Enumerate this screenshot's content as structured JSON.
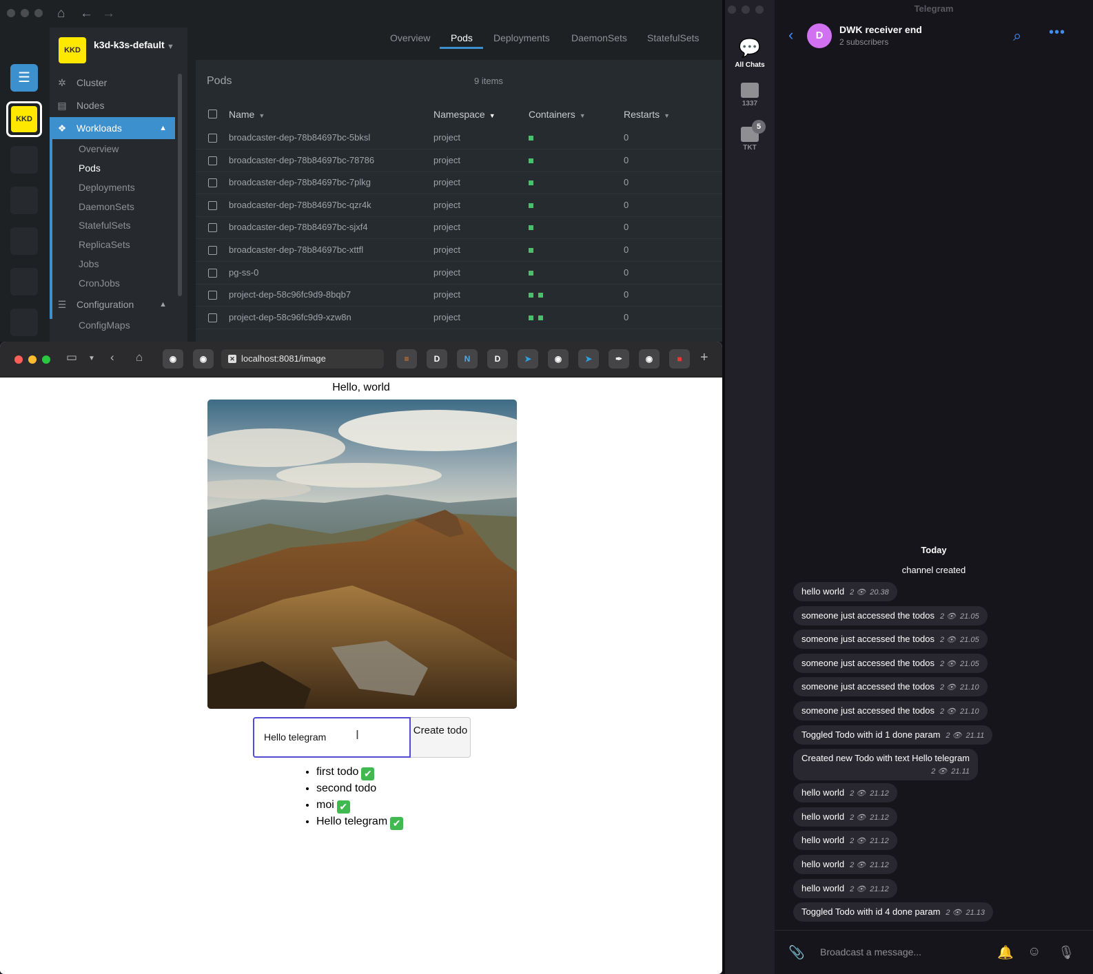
{
  "lens": {
    "cluster_badge": "KKD",
    "cluster_name": "k3d-k3s-default",
    "sidebar": {
      "items": [
        {
          "label": "Cluster"
        },
        {
          "label": "Nodes"
        },
        {
          "label": "Workloads"
        }
      ],
      "workloads_sub": [
        "Overview",
        "Pods",
        "Deployments",
        "DaemonSets",
        "StatefulSets",
        "ReplicaSets",
        "Jobs",
        "CronJobs"
      ],
      "configuration_label": "Configuration",
      "configuration_sub": [
        "ConfigMaps"
      ]
    },
    "tabs": [
      "Overview",
      "Pods",
      "Deployments",
      "DaemonSets",
      "StatefulSets"
    ],
    "pods_title": "Pods",
    "pods_count": "9 items",
    "columns": [
      "Name",
      "Namespace",
      "Containers",
      "Restarts"
    ],
    "rows": [
      {
        "name": "broadcaster-dep-78b84697bc-5bksl",
        "namespace": "project",
        "containers": 1,
        "restarts": "0"
      },
      {
        "name": "broadcaster-dep-78b84697bc-78786",
        "namespace": "project",
        "containers": 1,
        "restarts": "0"
      },
      {
        "name": "broadcaster-dep-78b84697bc-7plkg",
        "namespace": "project",
        "containers": 1,
        "restarts": "0"
      },
      {
        "name": "broadcaster-dep-78b84697bc-qzr4k",
        "namespace": "project",
        "containers": 1,
        "restarts": "0"
      },
      {
        "name": "broadcaster-dep-78b84697bc-sjxf4",
        "namespace": "project",
        "containers": 1,
        "restarts": "0"
      },
      {
        "name": "broadcaster-dep-78b84697bc-xttfl",
        "namespace": "project",
        "containers": 1,
        "restarts": "0"
      },
      {
        "name": "pg-ss-0",
        "namespace": "project",
        "containers": 1,
        "restarts": "0"
      },
      {
        "name": "project-dep-58c96fc9d9-8bqb7",
        "namespace": "project",
        "containers": 2,
        "restarts": "0"
      },
      {
        "name": "project-dep-58c96fc9d9-xzw8n",
        "namespace": "project",
        "containers": 2,
        "restarts": "0"
      }
    ],
    "status_color": "#48c16c",
    "accent": "#3d90ce"
  },
  "browser": {
    "url": "localhost:8081/image",
    "tab_badges": [
      "D",
      "D"
    ],
    "page": {
      "heading": "Hello, world",
      "input_value": "Hello telegram",
      "create_button": "Create todo",
      "todos": [
        {
          "text": "first todo",
          "done": true
        },
        {
          "text": "second todo",
          "done": false
        },
        {
          "text": "moi",
          "done": true
        },
        {
          "text": "Hello telegram",
          "done": true
        }
      ]
    }
  },
  "telegram": {
    "window_title": "Telegram",
    "folders": [
      {
        "label": "All Chats"
      },
      {
        "label": "1337"
      },
      {
        "label": "TKT",
        "badge": "5"
      }
    ],
    "channel": {
      "avatar_letter": "D",
      "name": "DWK receiver end",
      "subscribers": "2 subscribers"
    },
    "day_label": "Today",
    "system_message": "channel created",
    "messages": [
      {
        "text": "hello world",
        "views": "2",
        "time": "20.38"
      },
      {
        "text": "someone just accessed the todos",
        "views": "2",
        "time": "21.05"
      },
      {
        "text": "someone just accessed the todos",
        "views": "2",
        "time": "21.05"
      },
      {
        "text": "someone just accessed the todos",
        "views": "2",
        "time": "21.05"
      },
      {
        "text": "someone just accessed the todos",
        "views": "2",
        "time": "21.10"
      },
      {
        "text": "someone just accessed the todos",
        "views": "2",
        "time": "21.10"
      },
      {
        "text": "Toggled Todo with id 1 done param",
        "views": "2",
        "time": "21.11"
      },
      {
        "text": "Created new Todo with text Hello telegram",
        "views": "2",
        "time": "21.11"
      },
      {
        "text": "hello world",
        "views": "2",
        "time": "21.12"
      },
      {
        "text": "hello world",
        "views": "2",
        "time": "21.12"
      },
      {
        "text": "hello world",
        "views": "2",
        "time": "21.12"
      },
      {
        "text": "hello world",
        "views": "2",
        "time": "21.12"
      },
      {
        "text": "hello world",
        "views": "2",
        "time": "21.12"
      },
      {
        "text": "Toggled Todo with id 4 done param",
        "views": "2",
        "time": "21.13"
      }
    ],
    "compose_placeholder": "Broadcast a message..."
  }
}
